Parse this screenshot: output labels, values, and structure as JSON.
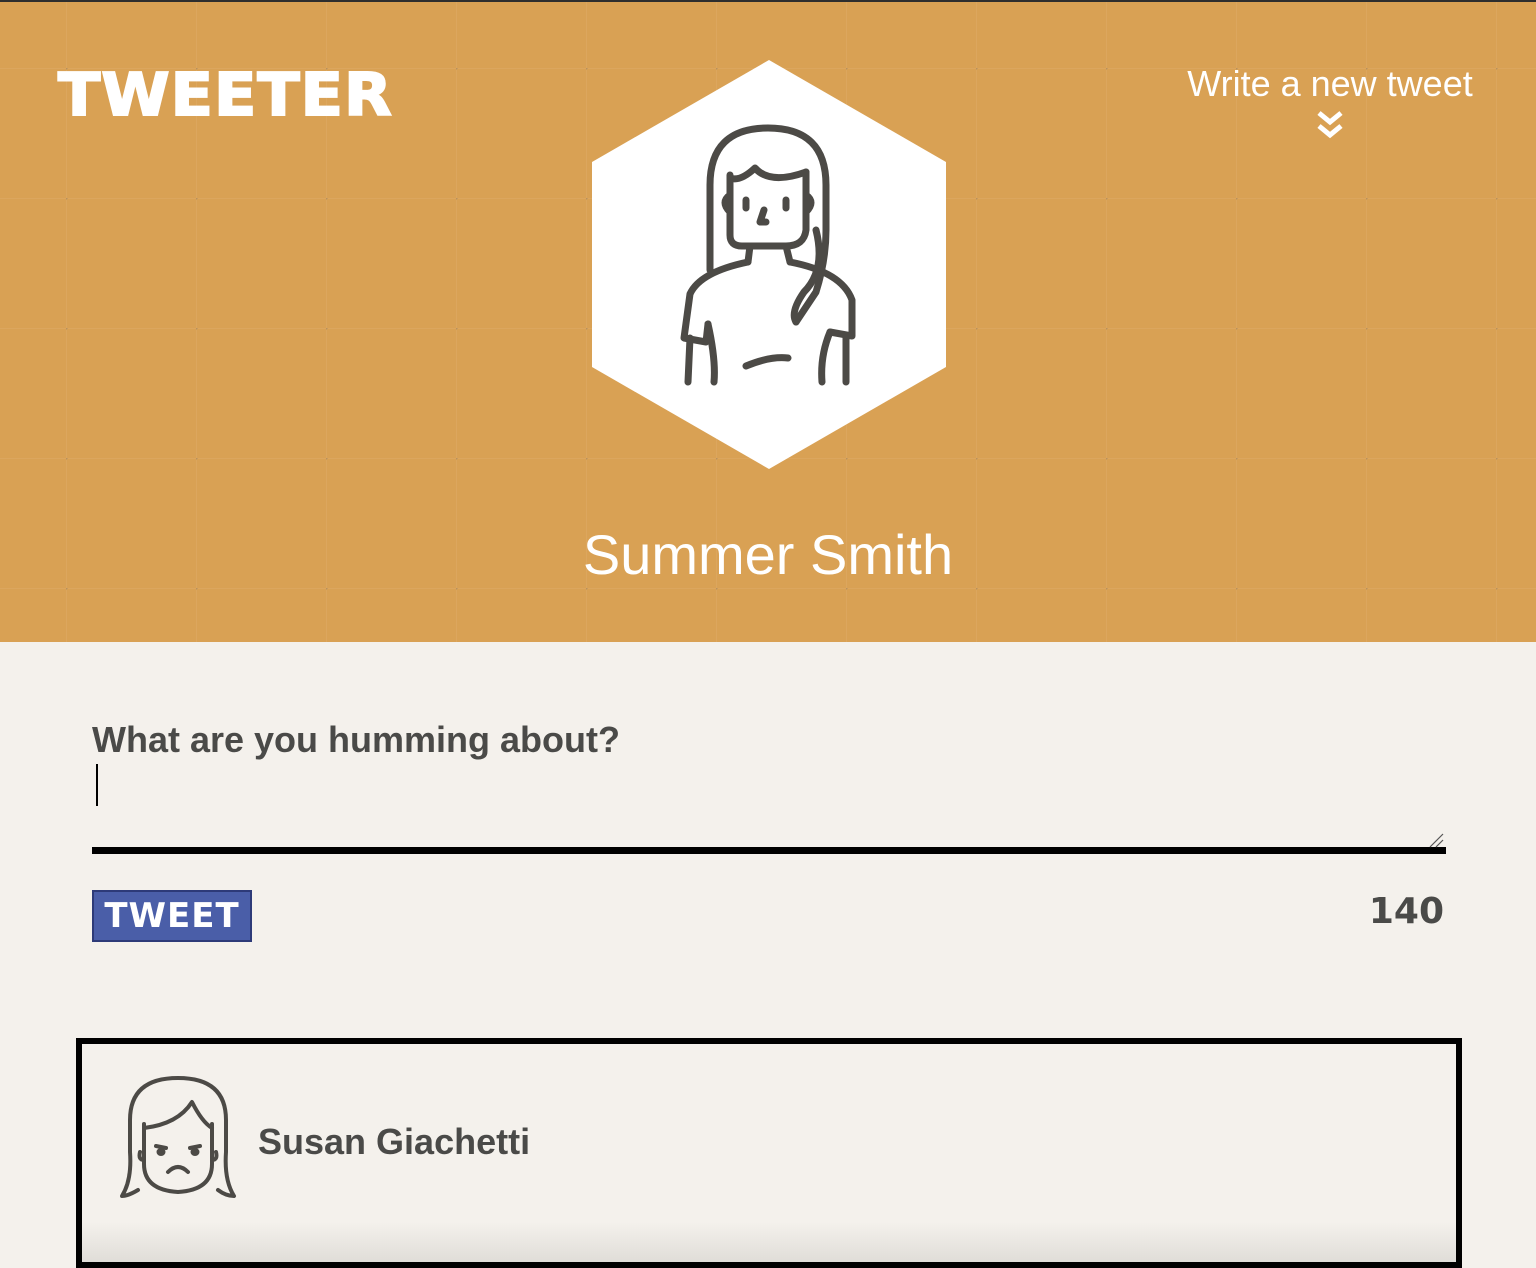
{
  "header": {
    "logo_text": "TWEETER",
    "write_link_label": "Write a new tweet",
    "write_link_icon": "double-chevron-down-icon",
    "background_color": "#d9a154"
  },
  "profile": {
    "name": "Summer Smith",
    "avatar_icon": "woman-avatar-icon"
  },
  "composer": {
    "label": "What are you humming about?",
    "value": "",
    "tweet_button_label": "TWEET",
    "tweet_button_color": "#4a5ea8",
    "char_counter": "140"
  },
  "tweets": [
    {
      "author": "Susan Giachetti",
      "avatar_icon": "sad-girl-avatar-icon"
    }
  ]
}
